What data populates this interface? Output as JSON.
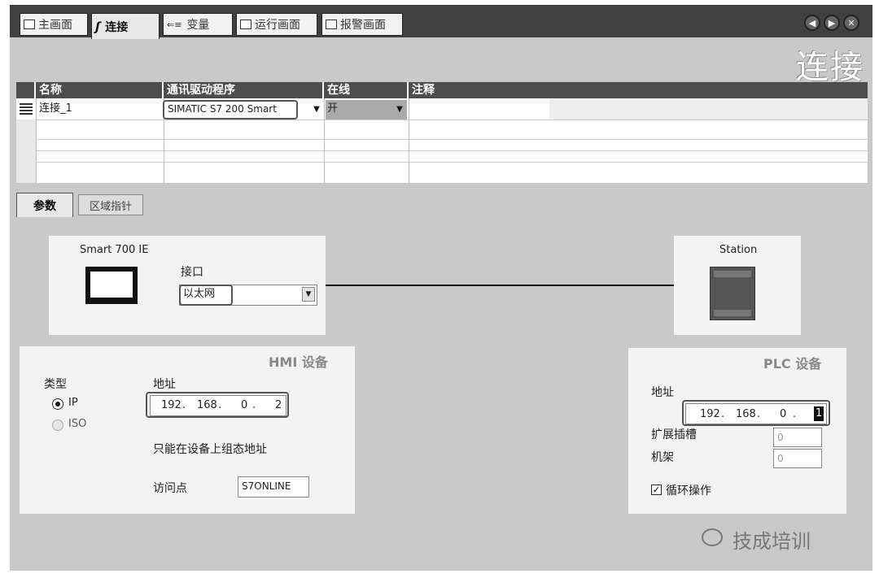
{
  "tabs": [
    {
      "label": "主画面",
      "icon": "screen-icon"
    },
    {
      "label": "连接",
      "icon": "connection-icon"
    },
    {
      "label": "变量",
      "icon": "variable-icon"
    },
    {
      "label": "运行画面",
      "icon": "screen-icon"
    },
    {
      "label": "报警画面",
      "icon": "screen-icon"
    }
  ],
  "page_title": "连接",
  "table": {
    "columns": [
      "名称",
      "通讯驱动程序",
      "在线",
      "注释"
    ],
    "rows": [
      {
        "name": "连接_1",
        "driver": "SIMATIC S7 200 Smart",
        "online": "开",
        "comment": ""
      }
    ]
  },
  "param_tabs": [
    "参数",
    "区域指针"
  ],
  "hmi_device": {
    "model": "Smart 700 IE",
    "interface_label": "接口",
    "interface_value": "以太网",
    "section_title": "HMI 设备",
    "type_label": "类型",
    "type_options": [
      "IP",
      "ISO"
    ],
    "address_label": "地址",
    "ip": [
      "192",
      "168",
      "0",
      "2"
    ],
    "note": "只能在设备上组态地址",
    "access_point_label": "访问点",
    "access_point_value": "S7ONLINE"
  },
  "plc_device": {
    "station_label": "Station",
    "section_title": "PLC 设备",
    "address_label": "地址",
    "ip": [
      "192",
      "168",
      "0",
      "1"
    ],
    "slot_label": "扩展插槽",
    "slot_value": "0",
    "rack_label": "机架",
    "rack_value": "0",
    "cyclic_label": "循环操作"
  },
  "watermark": "技成培训"
}
